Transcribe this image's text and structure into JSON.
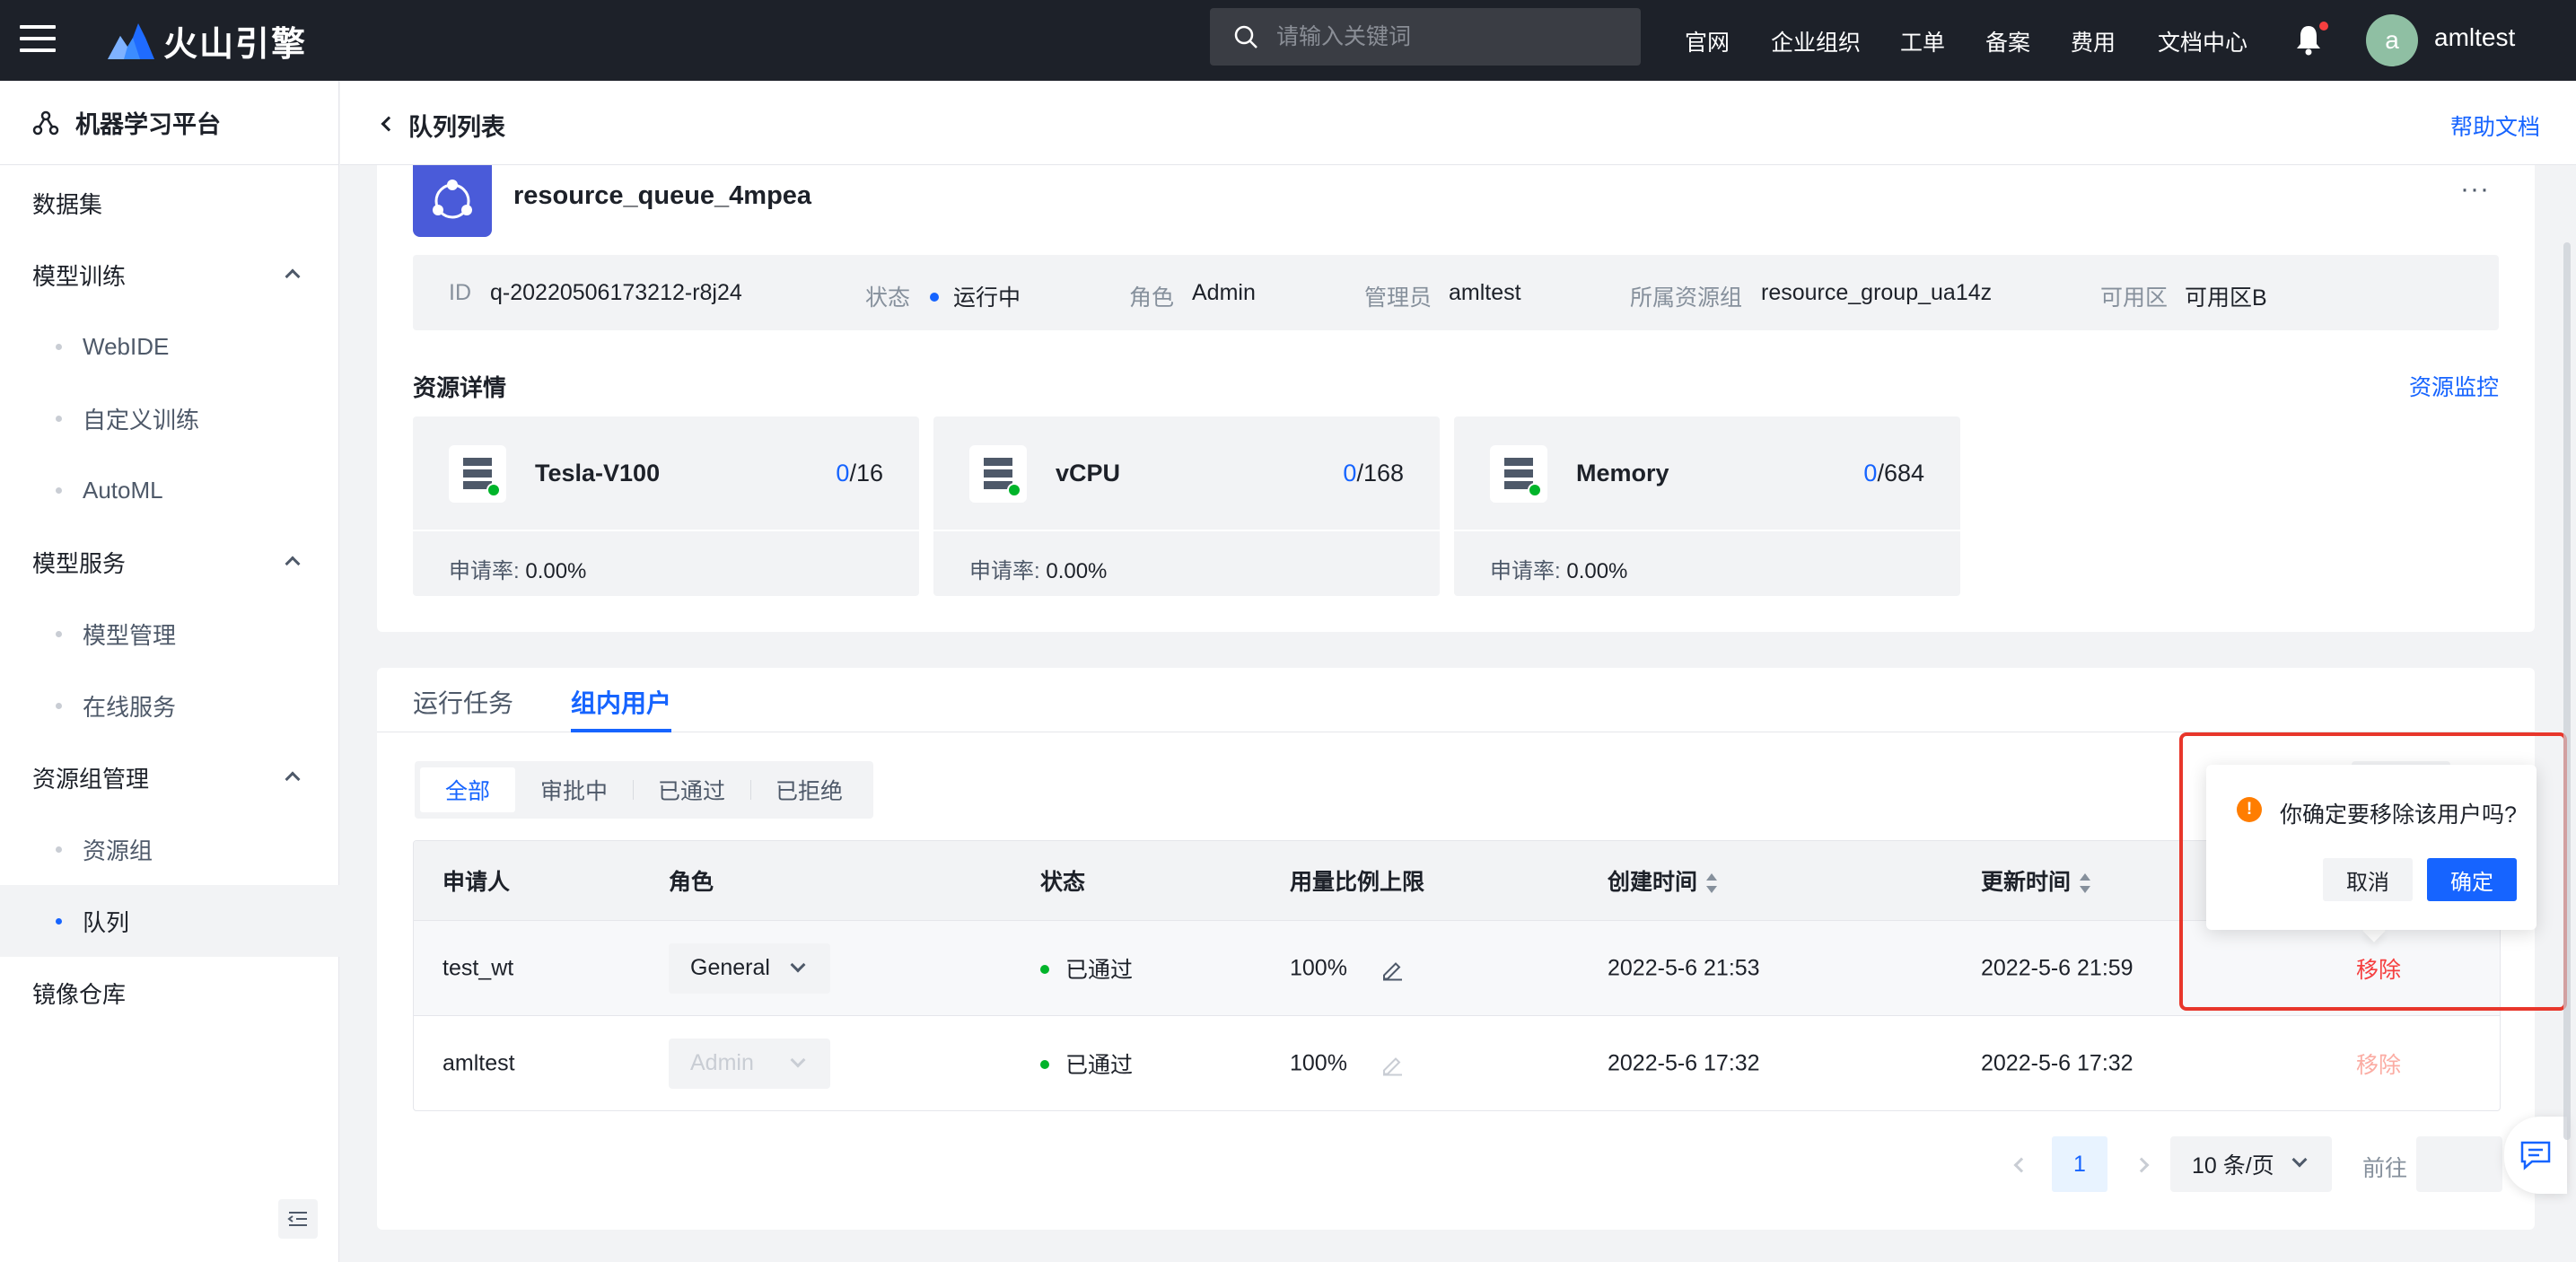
{
  "topbar": {
    "brand": "火山引擎",
    "search_placeholder": "请输入关键词",
    "nav": [
      "官网",
      "企业组织",
      "工单",
      "备案",
      "费用",
      "文档中心"
    ],
    "avatar_letter": "a",
    "username": "amltest"
  },
  "sidebar": {
    "title": "机器学习平台",
    "items": [
      {
        "label": "数据集"
      },
      {
        "label": "模型训练"
      },
      {
        "label": "WebIDE"
      },
      {
        "label": "自定义训练"
      },
      {
        "label": "AutoML"
      },
      {
        "label": "模型服务"
      },
      {
        "label": "模型管理"
      },
      {
        "label": "在线服务"
      },
      {
        "label": "资源组管理"
      },
      {
        "label": "资源组"
      },
      {
        "label": "队列"
      },
      {
        "label": "镜像仓库"
      }
    ]
  },
  "page": {
    "title": "队列列表",
    "help": "帮助文档"
  },
  "queue": {
    "name": "resource_queue_4mpea",
    "more": "···",
    "info": {
      "id_label": "ID",
      "id": "q-20220506173212-r8j24",
      "status_label": "状态",
      "status": "运行中",
      "status_color": "#1664ff",
      "role_label": "角色",
      "role": "Admin",
      "admin_label": "管理员",
      "admin": "amltest",
      "group_label": "所属资源组",
      "group": "resource_group_ua14z",
      "zone_label": "可用区",
      "zone": "可用区B"
    },
    "resource_title": "资源详情",
    "monitor_link": "资源监控",
    "resources": [
      {
        "name": "Tesla-V100",
        "used": "0",
        "total": "/16",
        "rate_label": "申请率:",
        "rate": "0.00%"
      },
      {
        "name": "vCPU",
        "used": "0",
        "total": "/168",
        "rate_label": "申请率:",
        "rate": "0.00%"
      },
      {
        "name": "Memory",
        "used": "0",
        "total": "/684",
        "rate_label": "申请率:",
        "rate": "0.00%"
      }
    ]
  },
  "users": {
    "tabs": [
      "运行任务",
      "组内用户"
    ],
    "filters": [
      "全部",
      "审批中",
      "已通过",
      "已拒绝"
    ],
    "columns": [
      "申请人",
      "角色",
      "状态",
      "用量比例上限",
      "创建时间",
      "更新时间"
    ],
    "rows": [
      {
        "applicant": "test_wt",
        "role": "General",
        "status": "已通过",
        "limit": "100%",
        "created": "2022-5-6 21:53",
        "updated": "2022-5-6 21:59",
        "action": "移除"
      },
      {
        "applicant": "amltest",
        "role": "Admin",
        "status": "已通过",
        "limit": "100%",
        "created": "2022-5-6 17:32",
        "updated": "2022-5-6 17:32",
        "action": "移除"
      }
    ],
    "pagination": {
      "page": "1",
      "page_size": "10 条/页",
      "goto": "前往"
    }
  },
  "popconfirm": {
    "icon": "!",
    "message": "你确定要移除该用户吗?",
    "cancel": "取消",
    "ok": "确定"
  },
  "colors": {
    "accent": "#1664ff",
    "danger": "#f53f3f",
    "success": "#00b42a",
    "warning": "#ff7d00",
    "highlight": "#e8362b"
  }
}
